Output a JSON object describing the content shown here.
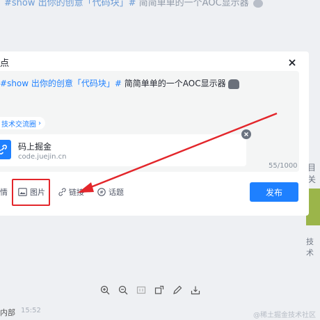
{
  "background": {
    "article_title_hash": "#",
    "article_title_part1": "show 出你的创意「代码块」",
    "article_title_hash2": "#",
    "article_title_part2": " 简简单单的一个AOC显示器",
    "right_text_a": "目关",
    "right_text_b": "技术",
    "bottom_text_a": "内部",
    "bottom_text_b": "15:52",
    "watermark": "@稀土掘金技术社区"
  },
  "dialog": {
    "title": "点",
    "close_icon": "close-icon",
    "editor": {
      "text_hash": "#",
      "text_part1": "show 出你的创意「代码块」",
      "text_hash2": "#",
      "text_part2": " 简简单单的一个AOC显示器",
      "emoji": "cat-emoji"
    },
    "circle_tag": {
      "label": "技术交流圈",
      "arrow": "›"
    },
    "link_card": {
      "title": "码上掘金",
      "url": "code.juejin.cn",
      "icon": "link-icon"
    },
    "char_count": "55/1000",
    "tools": {
      "partial_label": "情",
      "image_label": "图片",
      "link_label": "链接",
      "topic_label": "话题"
    },
    "publish_label": "发布"
  },
  "viewer_toolbar": [
    "zoom-in-icon",
    "zoom-out-icon",
    "fit-icon",
    "rotate-icon",
    "edit-icon",
    "download-icon"
  ],
  "colors": {
    "accent": "#1e80ff",
    "annotation": "#e3262b",
    "editor_bg": "#f4f5f5",
    "page_bg": "#eef0f3"
  }
}
